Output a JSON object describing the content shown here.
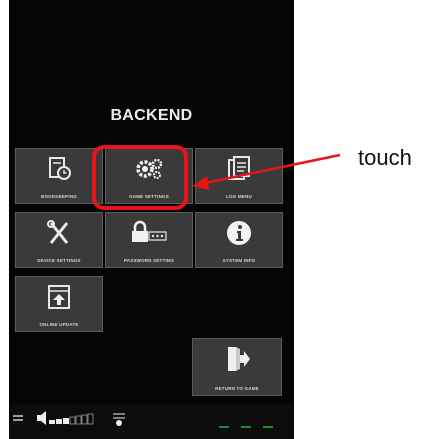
{
  "page_title": "BACKEND",
  "tiles": [
    {
      "label": "BOOKKEEPING",
      "icon": "bookkeeping-clock-icon"
    },
    {
      "label": "GAME SETTINGS",
      "icon": "gears-icon"
    },
    {
      "label": "LOG MENU",
      "icon": "log-document-icon"
    },
    {
      "label": "DEVICE SETTINGS",
      "icon": "tools-icon"
    },
    {
      "label": "PASSWORD SETTING",
      "icon": "lock-password-icon"
    },
    {
      "label": "SYSTEM INFO",
      "icon": "info-icon"
    },
    {
      "label": "ONLINE UPDATE",
      "icon": "upload-icon"
    },
    {
      "label": "RETURN TO GAME",
      "icon": "exit-door-icon"
    }
  ],
  "callout": {
    "text": "touch",
    "color": "#e5161a"
  },
  "colors": {
    "tile_bg": "#3a3a3a",
    "tile_border": "#5c5c5c",
    "screen_bg": "#050505",
    "status_green": "#1d8a2f"
  }
}
